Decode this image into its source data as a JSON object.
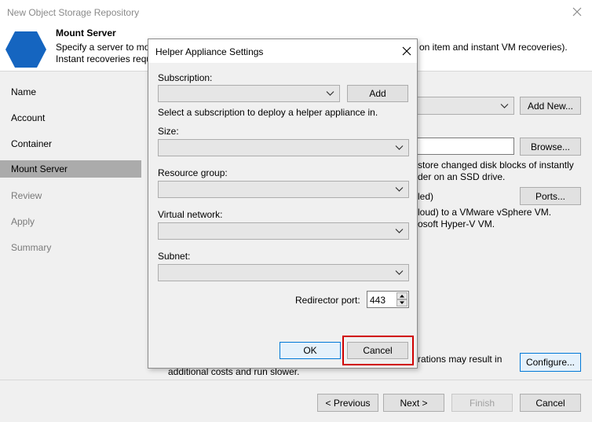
{
  "window": {
    "title": "New Object Storage Repository"
  },
  "header": {
    "title": "Mount Server",
    "desc_line1": "Specify a server to mo",
    "desc_line1_tail": "on item and instant VM recoveries).",
    "desc_line2": "Instant recoveries requ"
  },
  "nav": {
    "items": [
      {
        "label": "Name"
      },
      {
        "label": "Account"
      },
      {
        "label": "Container"
      },
      {
        "label": "Mount Server"
      },
      {
        "label": "Review"
      },
      {
        "label": "Apply"
      },
      {
        "label": "Summary"
      }
    ]
  },
  "main": {
    "add_new": "Add New...",
    "browse": "Browse...",
    "ssd_line1": "store changed disk blocks of instantly",
    "ssd_line2": "der on an SSD drive.",
    "led": "led)",
    "ports": "Ports...",
    "vmware": "loud) to a VMware vSphere VM.",
    "hyperv": "osoft Hyper-V VM.",
    "rations_line1": "rations may result in",
    "rations_line2": "additional costs and run slower.",
    "configure": "Configure..."
  },
  "footer": {
    "previous": "< Previous",
    "next": "Next >",
    "finish": "Finish",
    "cancel": "Cancel"
  },
  "dialog": {
    "title": "Helper Appliance Settings",
    "subscription_label": "Subscription:",
    "add": "Add",
    "subscription_hint": "Select a subscription to deploy a helper appliance in.",
    "size_label": "Size:",
    "resource_group_label": "Resource group:",
    "virtual_network_label": "Virtual network:",
    "subnet_label": "Subnet:",
    "redirector_port_label": "Redirector port:",
    "redirector_port_value": "443",
    "ok": "OK",
    "cancel": "Cancel"
  },
  "colors": {
    "logo": "#1565c0",
    "highlight": "#d00000",
    "focus": "#0078d7"
  }
}
